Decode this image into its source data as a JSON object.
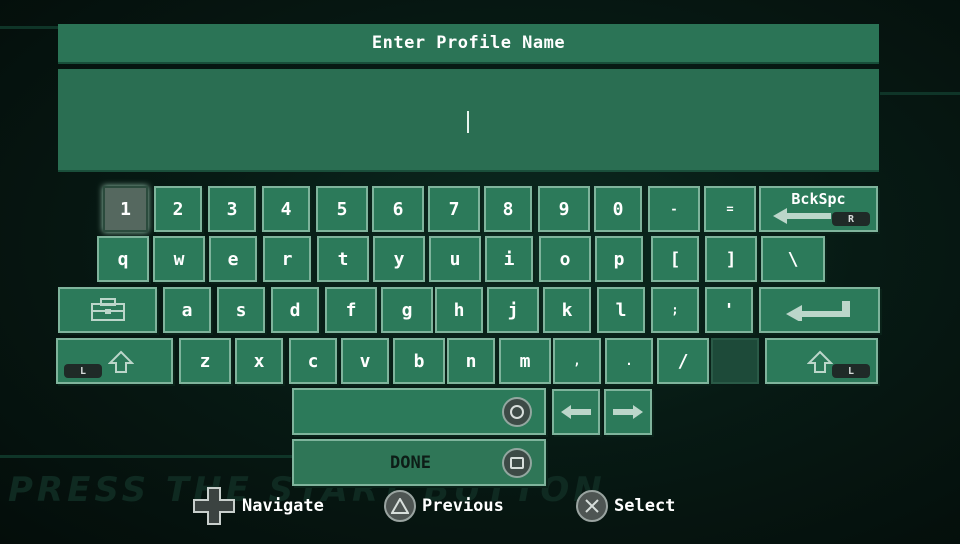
{
  "dialog": {
    "title": "Enter Profile Name",
    "input_value": ""
  },
  "keyboard": {
    "row1": [
      "1",
      "2",
      "3",
      "4",
      "5",
      "6",
      "7",
      "8",
      "9",
      "0",
      "-",
      "="
    ],
    "backspace_label": "BckSpc",
    "backspace_badge": "R",
    "row2": [
      "q",
      "w",
      "e",
      "r",
      "t",
      "y",
      "u",
      "i",
      "o",
      "p",
      "[",
      "]",
      "\\"
    ],
    "row3": [
      "a",
      "s",
      "d",
      "f",
      "g",
      "h",
      "j",
      "k",
      "l",
      ";",
      "'"
    ],
    "row4": [
      "z",
      "x",
      "c",
      "v",
      "b",
      "n",
      "m",
      ",",
      ".",
      "/"
    ],
    "shift_badge": "L",
    "done_label": "DONE"
  },
  "legend": {
    "navigate": "Navigate",
    "previous": "Previous",
    "select": "Select"
  },
  "background_text": "PRESS THE START BUTTON",
  "colors": {
    "key_fill": "#2c7a5a",
    "key_border": "#7fb49c",
    "title_bar": "#2b7456",
    "background": "#071a14"
  },
  "icons": [
    "toolbox-icon",
    "enter-arrow-icon",
    "shift-up-icon",
    "left-arrow-icon",
    "right-arrow-icon",
    "circle-button-icon",
    "square-button-icon",
    "dpad-icon",
    "triangle-button-icon",
    "cross-button-icon"
  ]
}
